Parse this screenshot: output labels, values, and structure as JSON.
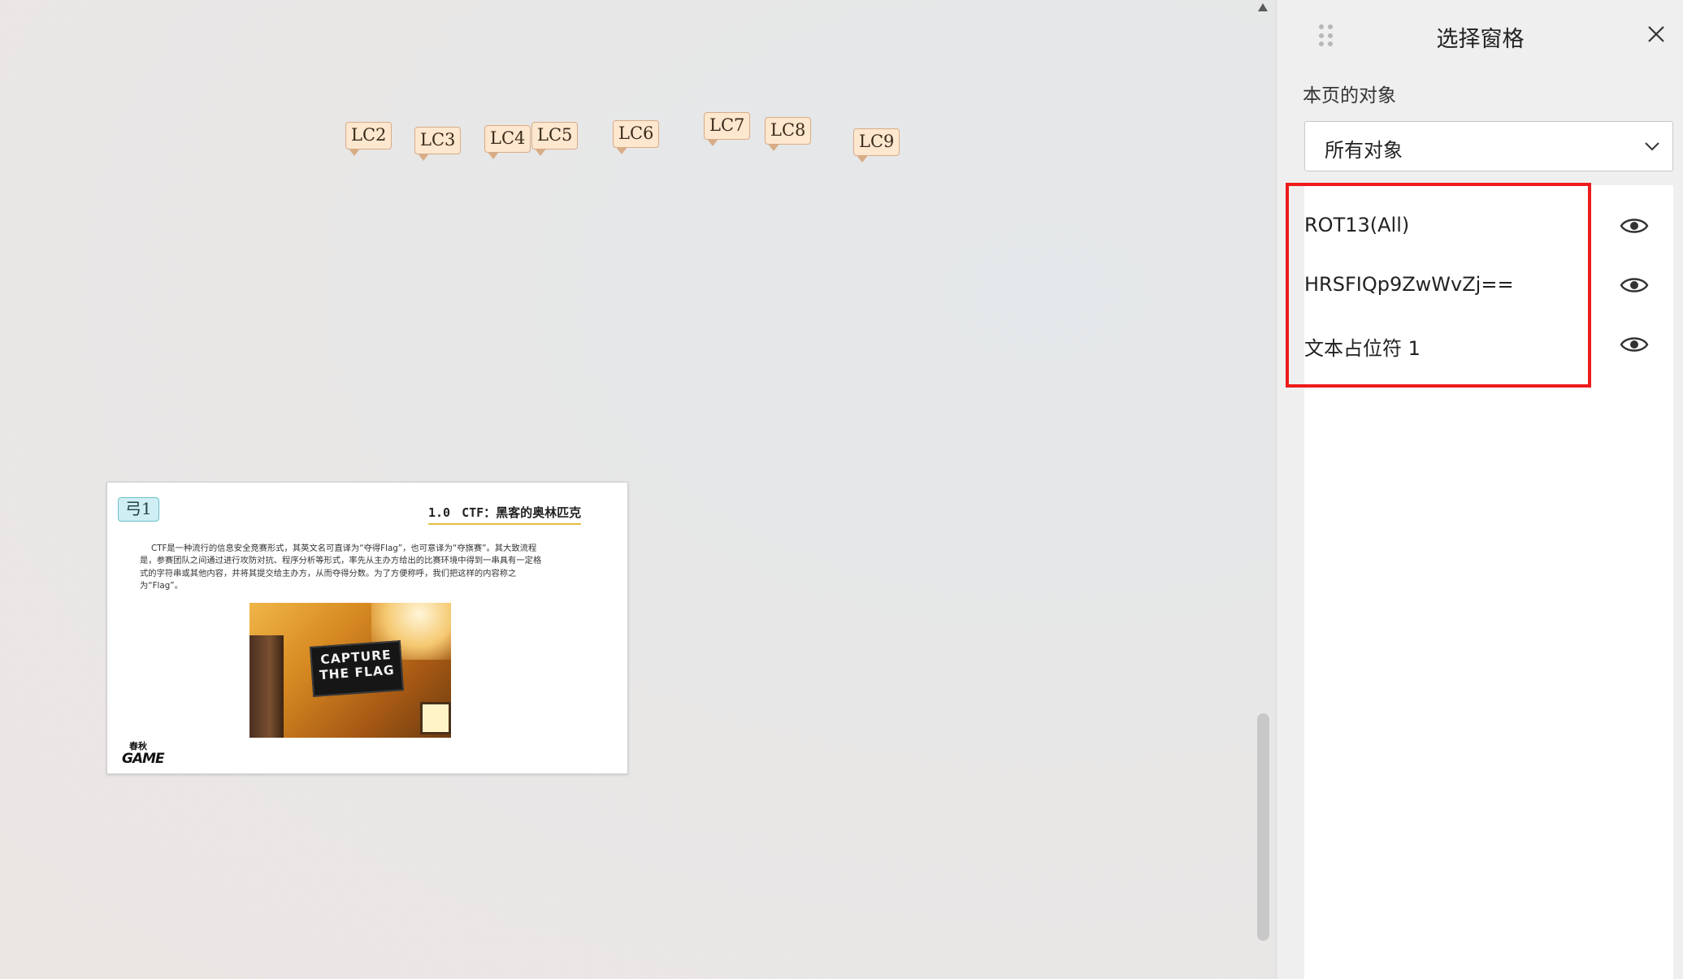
{
  "canvas": {
    "comment_markers": [
      "LC2",
      "LC3",
      "LC4",
      "LC5",
      "LC6",
      "LC7",
      "LC8",
      "LC9"
    ]
  },
  "slide": {
    "marker": "弓1",
    "heading_number": "1.0",
    "heading_title": "CTF：黑客的奥林匹克",
    "body": "CTF是一种流行的信息安全竞赛形式，其英文名可直译为“夺得Flag”，也可意译为“夺旗赛”。其大致流程是，参赛团队之间通过进行攻防对抗、程序分析等形式，率先从主办方给出的比赛环境中得到一串具有一定格式的字符串或其他内容，并将其提交给主办方，从而夺得分数。为了方便称呼，我们把这样的内容称之为“Flag”。",
    "photo_sign_line1": "CAPTURE",
    "photo_sign_line2": "THE FLAG",
    "logo_top": "春秋",
    "logo_bottom": "GAME"
  },
  "pane": {
    "title": "选择窗格",
    "section_label": "本页的对象",
    "filter_value": "所有对象",
    "objects": [
      {
        "name": "ROT13(All)",
        "icon": "eye-icon"
      },
      {
        "name": "HRSFIQp9ZwWvZj==",
        "icon": "eye-icon"
      },
      {
        "name": "文本占位符 1",
        "icon": "eye-icon"
      }
    ],
    "highlight_color": "#ee1b1b"
  }
}
